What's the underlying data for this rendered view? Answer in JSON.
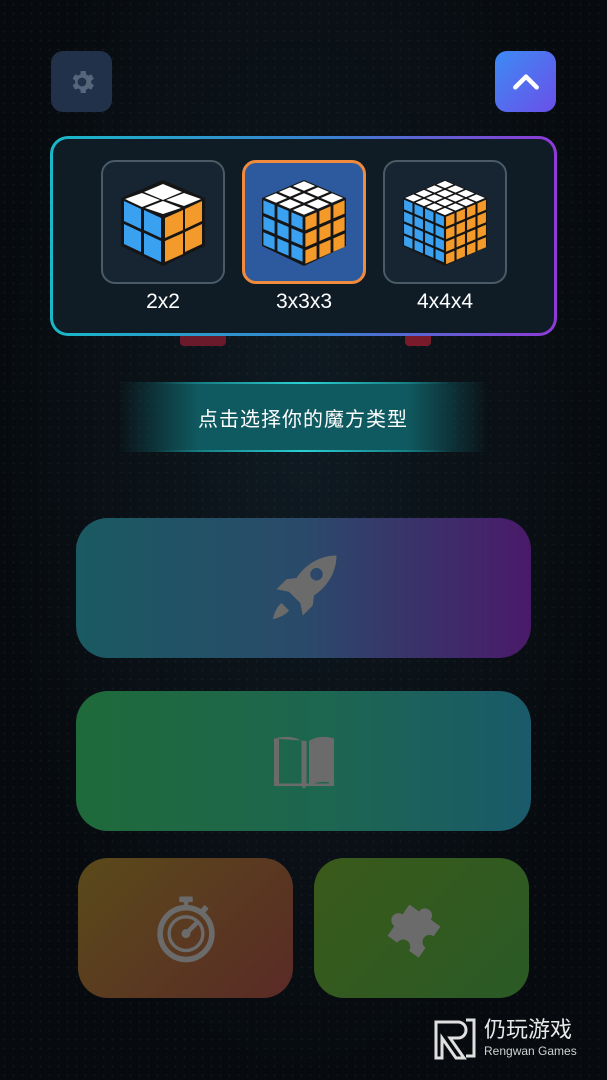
{
  "toolbar": {
    "settings_icon": "gear-icon",
    "collapse_icon": "chevron-up-icon"
  },
  "cube_selector": {
    "options": [
      {
        "label": "2x2",
        "icon": "rubiks-cube-2x2-icon",
        "selected": false
      },
      {
        "label": "3x3x3",
        "icon": "rubiks-cube-3x3-icon",
        "selected": true
      },
      {
        "label": "4x4x4",
        "icon": "rubiks-cube-4x4-icon",
        "selected": false
      }
    ]
  },
  "hint": {
    "text": "点击选择你的魔方类型"
  },
  "menu": {
    "play_icon": "rocket-icon",
    "learn_icon": "book-icon",
    "timer_icon": "stopwatch-icon",
    "puzzle_icon": "puzzle-piece-icon"
  },
  "watermark": {
    "brand_cn": "仍玩游戏",
    "brand_en": "Rengwan Games"
  },
  "colors": {
    "accent_orange": "#f08a3c",
    "accent_blue": "#2d5a9e",
    "cube_blue": "#3aa0f0",
    "cube_orange": "#f39a2a",
    "icon_gray": "#6b6b6b"
  }
}
